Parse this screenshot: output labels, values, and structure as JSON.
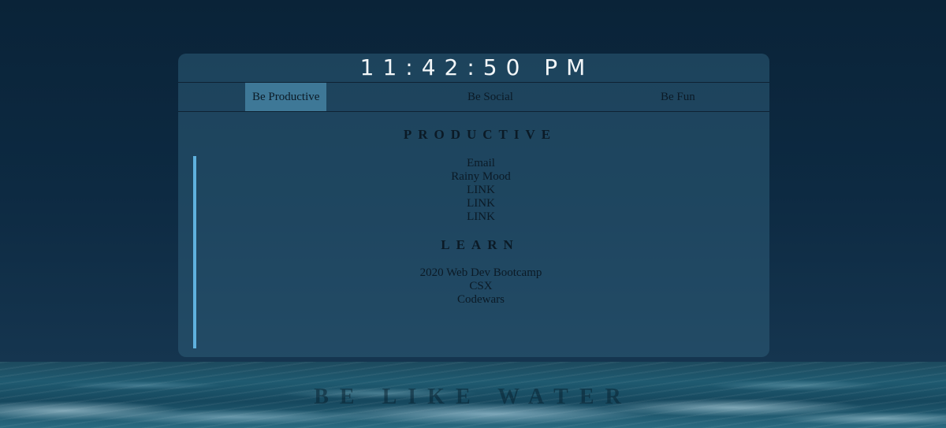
{
  "clock": {
    "time": "11:42:50 PM"
  },
  "tabs": [
    {
      "label": "Be Productive",
      "active": true
    },
    {
      "label": "Be Social",
      "active": false
    },
    {
      "label": "Be Fun",
      "active": false
    }
  ],
  "sections": {
    "productive": {
      "heading": "PRODUCTIVE",
      "links": [
        "Email",
        "Rainy Mood",
        "LINK",
        "LINK",
        "LINK"
      ]
    },
    "learn": {
      "heading": "LEARN",
      "links": [
        "2020 Web Dev Bootcamp",
        "CSX",
        "Codewars"
      ]
    }
  },
  "footer": {
    "tagline": "BE LIKE WATER"
  },
  "colors": {
    "active_tab": "#3e7897",
    "accent_bar": "#5fb1de",
    "panel": "#2e5c78"
  }
}
